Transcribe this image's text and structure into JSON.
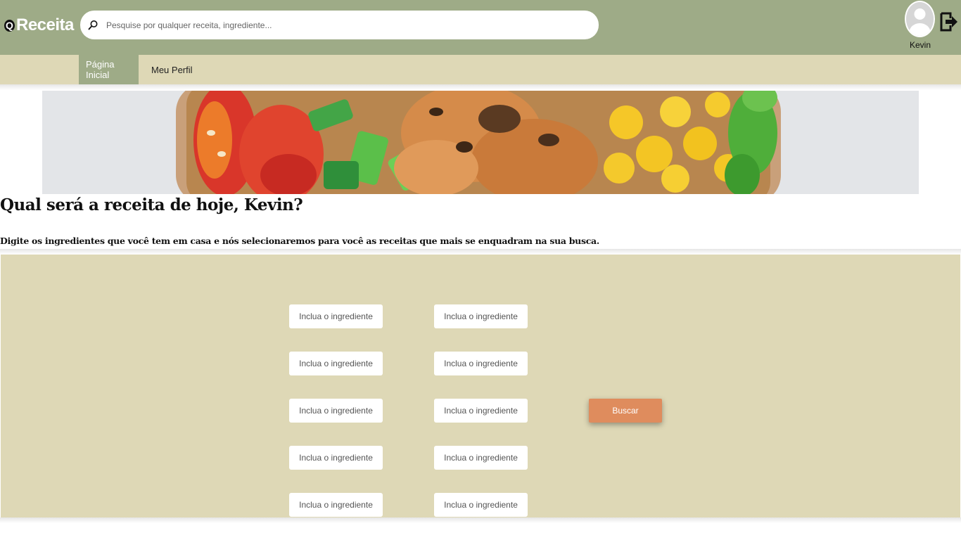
{
  "header": {
    "logo_mark": "Q",
    "logo_text": "Receita",
    "search_placeholder": "Pesquise por qualquer receita, ingrediente...",
    "user_name": "Kevin"
  },
  "nav": {
    "tabs": [
      {
        "label": "Página Inicial",
        "active": true
      },
      {
        "label": "Meu Perfil",
        "active": false
      }
    ]
  },
  "main": {
    "heading": "Qual será a receita de hoje, Kevin?",
    "subheading": "Digite os ingredientes que você tem em casa e nós selecionaremos para você as receitas que mais se enquadram na sua busca."
  },
  "ingredients": {
    "placeholders": [
      "Inclua o ingrediente",
      "Inclua o ingrediente",
      "Inclua o ingrediente",
      "Inclua o ingrediente",
      "Inclua o ingrediente",
      "Inclua o ingrediente",
      "Inclua o ingrediente",
      "Inclua o ingrediente",
      "Inclua o ingrediente",
      "Inclua o ingrediente"
    ],
    "search_button": "Buscar"
  },
  "colors": {
    "header_bg": "#9eab87",
    "nav_bg": "#ded8b6",
    "panel_bg": "#ded8b6",
    "button_bg": "#df8c5d"
  }
}
